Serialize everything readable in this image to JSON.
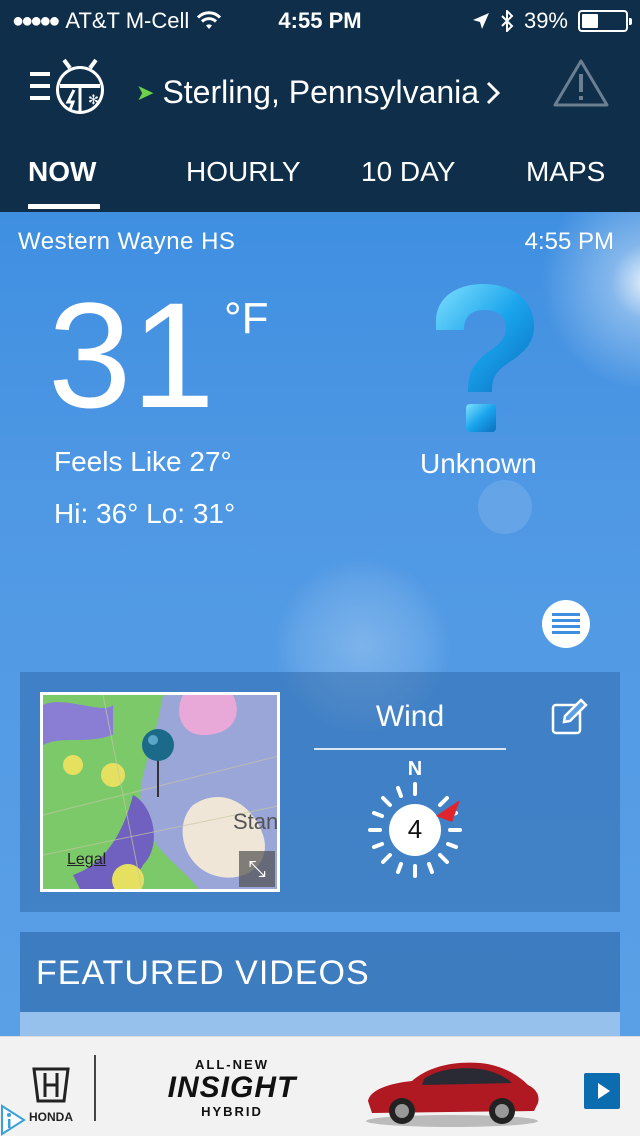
{
  "status_bar": {
    "signal_dots": "●●●●●",
    "carrier": "AT&T M-Cell",
    "time": "4:55 PM",
    "battery": "39%",
    "battery_level": 0.39
  },
  "header": {
    "location": "Sterling,  Pennsylvania",
    "tabs": [
      {
        "label": "NOW",
        "active": true
      },
      {
        "label": "HOURLY",
        "active": false
      },
      {
        "label": "10  DAY",
        "active": false
      },
      {
        "label": "MAPS",
        "active": false
      }
    ]
  },
  "current": {
    "station": "Western  Wayne  HS",
    "obs_time": "4:55  PM",
    "temperature": "31",
    "unit": "°F",
    "feels_like": "Feels  Like  27°",
    "hilo": "Hi: 36°  Lo: 31°",
    "condition": "Unknown",
    "condition_icon": "question-icon"
  },
  "card": {
    "radar_city": "Stan",
    "legal": "Legal",
    "wind_title": "Wind",
    "wind_direction_label": "N",
    "wind_speed": "4"
  },
  "featured": {
    "title": "FEATURED  VIDEOS"
  },
  "ad": {
    "brand": "HONDA",
    "allnew": "ALL-NEW",
    "model": "INSIGHT",
    "hybrid": "HYBRID"
  },
  "colors": {
    "header_bg": "#0e2e4a",
    "sky_blue": "#4f98e4",
    "location_arrow": "#6fd14a",
    "wind_arrow": "#e0242b"
  }
}
